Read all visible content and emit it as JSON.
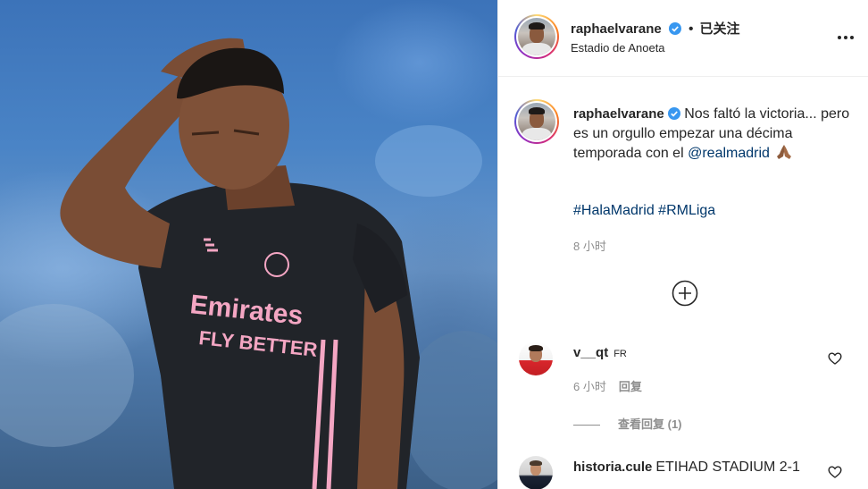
{
  "post": {
    "username": "raphaelvarane",
    "follow_label": "已关注",
    "location": "Estadio de Anoeta",
    "image_description": "player photo",
    "verified_icon": "verified-badge-icon",
    "more_icon": "more-options-icon"
  },
  "caption": {
    "username": "raphaelvarane",
    "text_before_mention": "Nos faltó la victoria... pero es un orgullo empezar una décima temporada con el",
    "mention": "@realmadrid",
    "emoji_icon": "folded-hands-icon",
    "hashtag_1": "#HalaMadrid",
    "hashtag_2": "#RMLiga",
    "time": "8 小时"
  },
  "load_more_icon": "plus-circle-icon",
  "comments": [
    {
      "username": "v__qt",
      "flag": "FR",
      "text": "",
      "time": "6 小时",
      "reply_label": "回复",
      "view_replies_label": "查看回复 (1)"
    },
    {
      "username": "historia.cule",
      "text": "ETIHAD STADIUM 2-1"
    }
  ],
  "colors": {
    "link": "#00376b",
    "meta": "#8e8e8e",
    "verified": "#3897f0",
    "jersey": "#1d1f24",
    "stripe_pink": "#f4a6c3"
  }
}
